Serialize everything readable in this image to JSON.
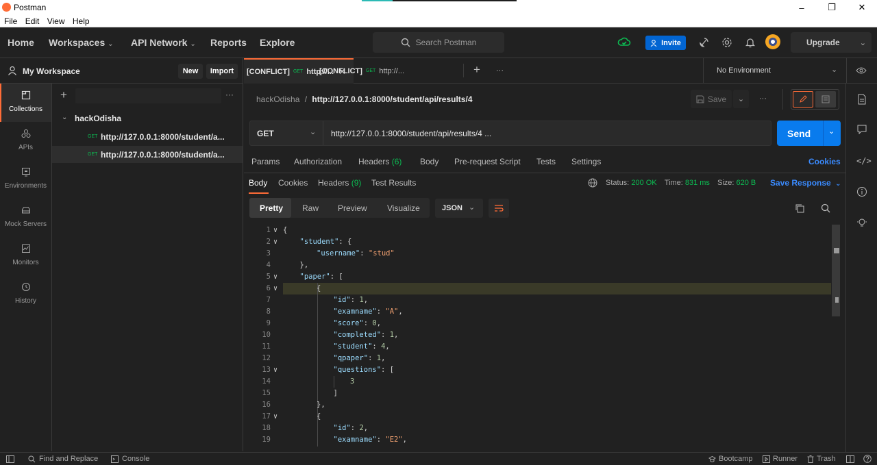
{
  "window": {
    "title": "Postman"
  },
  "menu": [
    "File",
    "Edit",
    "View",
    "Help"
  ],
  "nav": {
    "home": "Home",
    "workspaces": "Workspaces",
    "api_network": "API Network",
    "reports": "Reports",
    "explore": "Explore",
    "search_placeholder": "Search Postman",
    "invite": "Invite",
    "upgrade": "Upgrade"
  },
  "workspace": {
    "name": "My Workspace",
    "new_label": "New",
    "import_label": "Import"
  },
  "rail": [
    {
      "label": "Collections",
      "icon": "collections-icon"
    },
    {
      "label": "APIs",
      "icon": "apis-icon"
    },
    {
      "label": "Environments",
      "icon": "environments-icon"
    },
    {
      "label": "Mock Servers",
      "icon": "mock-servers-icon"
    },
    {
      "label": "Monitors",
      "icon": "monitors-icon"
    },
    {
      "label": "History",
      "icon": "history-icon"
    }
  ],
  "collection": {
    "name": "hackOdisha",
    "requests": [
      {
        "method": "GET",
        "url": "http://127.0.0.1:8000/student/a..."
      },
      {
        "method": "GET",
        "url": "http://127.0.0.1:8000/student/a..."
      }
    ]
  },
  "tabs": [
    {
      "prefix": "[CONFLICT]",
      "method": "GET",
      "label": "http://..."
    },
    {
      "prefix": "[CONFLICT]",
      "method": "GET",
      "label": "http://..."
    }
  ],
  "environment": "No Environment",
  "request": {
    "breadcrumb_collection": "hackOdisha",
    "breadcrumb_sep": "/",
    "breadcrumb_name": "http://127.0.0.1:8000/student/api/results/4",
    "save_label": "Save",
    "method": "GET",
    "url": "http://127.0.0.1:8000/student/api/results/4 ...",
    "send_label": "Send",
    "subtabs": {
      "params": "Params",
      "authorization": "Authorization",
      "headers": "Headers",
      "headers_count": "(6)",
      "body": "Body",
      "prerequest": "Pre-request Script",
      "tests": "Tests",
      "settings": "Settings",
      "cookies": "Cookies"
    }
  },
  "response": {
    "tabs": {
      "body": "Body",
      "cookies": "Cookies",
      "headers": "Headers",
      "headers_count": "(9)",
      "test_results": "Test Results"
    },
    "status_label": "Status:",
    "status_value": "200 OK",
    "time_label": "Time:",
    "time_value": "831 ms",
    "size_label": "Size:",
    "size_value": "620 B",
    "save_response": "Save Response",
    "view_modes": [
      "Pretty",
      "Raw",
      "Preview",
      "Visualize"
    ],
    "format": "JSON",
    "code_lines": [
      {
        "n": "1",
        "fold": true,
        "indent": 0,
        "parts": [
          [
            "p",
            "{"
          ]
        ]
      },
      {
        "n": "2",
        "fold": true,
        "indent": 1,
        "parts": [
          [
            "k",
            "\"student\""
          ],
          [
            "p",
            ": {"
          ]
        ]
      },
      {
        "n": "3",
        "fold": false,
        "indent": 2,
        "parts": [
          [
            "k",
            "\"username\""
          ],
          [
            "p",
            ": "
          ],
          [
            "s",
            "\"stud\""
          ]
        ]
      },
      {
        "n": "4",
        "fold": false,
        "indent": 1,
        "parts": [
          [
            "p",
            "},"
          ]
        ]
      },
      {
        "n": "5",
        "fold": true,
        "indent": 1,
        "parts": [
          [
            "k",
            "\"paper\""
          ],
          [
            "p",
            ": ["
          ]
        ]
      },
      {
        "n": "6",
        "fold": true,
        "indent": 2,
        "parts": [
          [
            "p",
            "{"
          ]
        ]
      },
      {
        "n": "7",
        "fold": false,
        "indent": 3,
        "parts": [
          [
            "k",
            "\"id\""
          ],
          [
            "p",
            ": "
          ],
          [
            "n",
            "1"
          ],
          [
            "p",
            ","
          ]
        ]
      },
      {
        "n": "8",
        "fold": false,
        "indent": 3,
        "parts": [
          [
            "k",
            "\"examname\""
          ],
          [
            "p",
            ": "
          ],
          [
            "s",
            "\"A\""
          ],
          [
            "p",
            ","
          ]
        ]
      },
      {
        "n": "9",
        "fold": false,
        "indent": 3,
        "parts": [
          [
            "k",
            "\"score\""
          ],
          [
            "p",
            ": "
          ],
          [
            "n",
            "0"
          ],
          [
            "p",
            ","
          ]
        ]
      },
      {
        "n": "10",
        "fold": false,
        "indent": 3,
        "parts": [
          [
            "k",
            "\"completed\""
          ],
          [
            "p",
            ": "
          ],
          [
            "n",
            "1"
          ],
          [
            "p",
            ","
          ]
        ]
      },
      {
        "n": "11",
        "fold": false,
        "indent": 3,
        "parts": [
          [
            "k",
            "\"student\""
          ],
          [
            "p",
            ": "
          ],
          [
            "n",
            "4"
          ],
          [
            "p",
            ","
          ]
        ]
      },
      {
        "n": "12",
        "fold": false,
        "indent": 3,
        "parts": [
          [
            "k",
            "\"qpaper\""
          ],
          [
            "p",
            ": "
          ],
          [
            "n",
            "1"
          ],
          [
            "p",
            ","
          ]
        ]
      },
      {
        "n": "13",
        "fold": true,
        "indent": 3,
        "parts": [
          [
            "k",
            "\"questions\""
          ],
          [
            "p",
            ": ["
          ]
        ]
      },
      {
        "n": "14",
        "fold": false,
        "indent": 4,
        "parts": [
          [
            "n",
            "3"
          ]
        ]
      },
      {
        "n": "15",
        "fold": false,
        "indent": 3,
        "parts": [
          [
            "p",
            "]"
          ]
        ]
      },
      {
        "n": "16",
        "fold": false,
        "indent": 2,
        "parts": [
          [
            "p",
            "},"
          ]
        ]
      },
      {
        "n": "17",
        "fold": true,
        "indent": 2,
        "parts": [
          [
            "p",
            "{"
          ]
        ]
      },
      {
        "n": "18",
        "fold": false,
        "indent": 3,
        "parts": [
          [
            "k",
            "\"id\""
          ],
          [
            "p",
            ": "
          ],
          [
            "n",
            "2"
          ],
          [
            "p",
            ","
          ]
        ]
      },
      {
        "n": "19",
        "fold": false,
        "indent": 3,
        "parts": [
          [
            "k",
            "\"examname\""
          ],
          [
            "p",
            ": "
          ],
          [
            "s",
            "\"E2\""
          ],
          [
            "p",
            ","
          ]
        ]
      }
    ]
  },
  "statusbar": {
    "find_replace": "Find and Replace",
    "console": "Console",
    "bootcamp": "Bootcamp",
    "runner": "Runner",
    "trash": "Trash"
  },
  "colors": {
    "accent": "#ff6c37",
    "send": "#097bed",
    "invite": "#0265d2",
    "success": "#0cbb52",
    "link": "#3a8bff"
  }
}
